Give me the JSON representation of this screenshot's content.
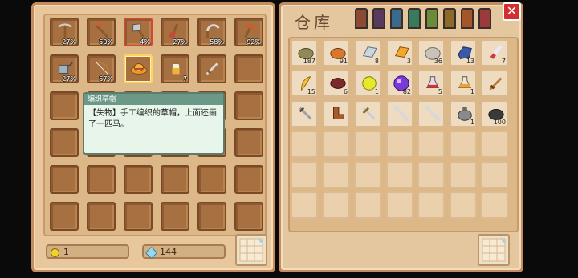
{
  "storage_title": "仓库",
  "tooltip": {
    "title": "编织草帽",
    "body": "【失物】手工编织的草帽，上面还画了一匹马。"
  },
  "currency": {
    "coins": "1",
    "gems": "144"
  },
  "tab_colors": [
    "#8c4a34",
    "#5a3a5c",
    "#3a6a8c",
    "#3a7a5c",
    "#6a8c3a",
    "#8c6a2a",
    "#a4562a",
    "#9a3a3a"
  ],
  "inventory": [
    {
      "icon": "pickaxe-icon",
      "label": "27%"
    },
    {
      "icon": "hoe-icon",
      "label": "50%"
    },
    {
      "icon": "axe-icon",
      "label": "4%",
      "red": true
    },
    {
      "icon": "shovel-icon",
      "label": "27%"
    },
    {
      "icon": "sickle-icon",
      "label": "58%"
    },
    {
      "icon": "hammer-icon",
      "label": "92%"
    },
    {
      "icon": "watering-can-icon",
      "label": "27%"
    },
    {
      "icon": "bow-icon",
      "label": "57%"
    },
    {
      "icon": "straw-hat-icon",
      "label": "",
      "selected": true
    },
    {
      "icon": "bottle-icon",
      "label": "7"
    },
    {
      "icon": "sword-icon",
      "label": ""
    }
  ],
  "storage_items": [
    {
      "icon": "stone-ore-icon",
      "label": "187"
    },
    {
      "icon": "copper-ore-icon",
      "label": "91"
    },
    {
      "icon": "silver-ingot-icon",
      "label": "8"
    },
    {
      "icon": "gold-ingot-icon",
      "label": "3"
    },
    {
      "icon": "rock-icon",
      "label": "36"
    },
    {
      "icon": "crystal-ore-icon",
      "label": "13"
    },
    {
      "icon": "potion-tube-icon",
      "label": "7"
    },
    {
      "icon": "feather-icon",
      "label": "15"
    },
    {
      "icon": "meat-icon",
      "label": "6"
    },
    {
      "icon": "yellow-orb-icon",
      "label": "1"
    },
    {
      "icon": "purple-orb-icon",
      "label": "82"
    },
    {
      "icon": "red-potion-icon",
      "label": "5"
    },
    {
      "icon": "orange-potion-icon",
      "label": "1"
    },
    {
      "icon": "wooden-sword-icon",
      "label": ""
    },
    {
      "icon": "iron-sword-icon",
      "label": ""
    },
    {
      "icon": "leather-boot-icon",
      "label": ""
    },
    {
      "icon": "steel-sword-icon",
      "label": ""
    },
    {
      "icon": "bone-icon",
      "label": ""
    },
    {
      "icon": "bone-icon",
      "label": ""
    },
    {
      "icon": "iron-pot-icon",
      "label": "1"
    },
    {
      "icon": "coal-icon",
      "label": "100"
    }
  ]
}
